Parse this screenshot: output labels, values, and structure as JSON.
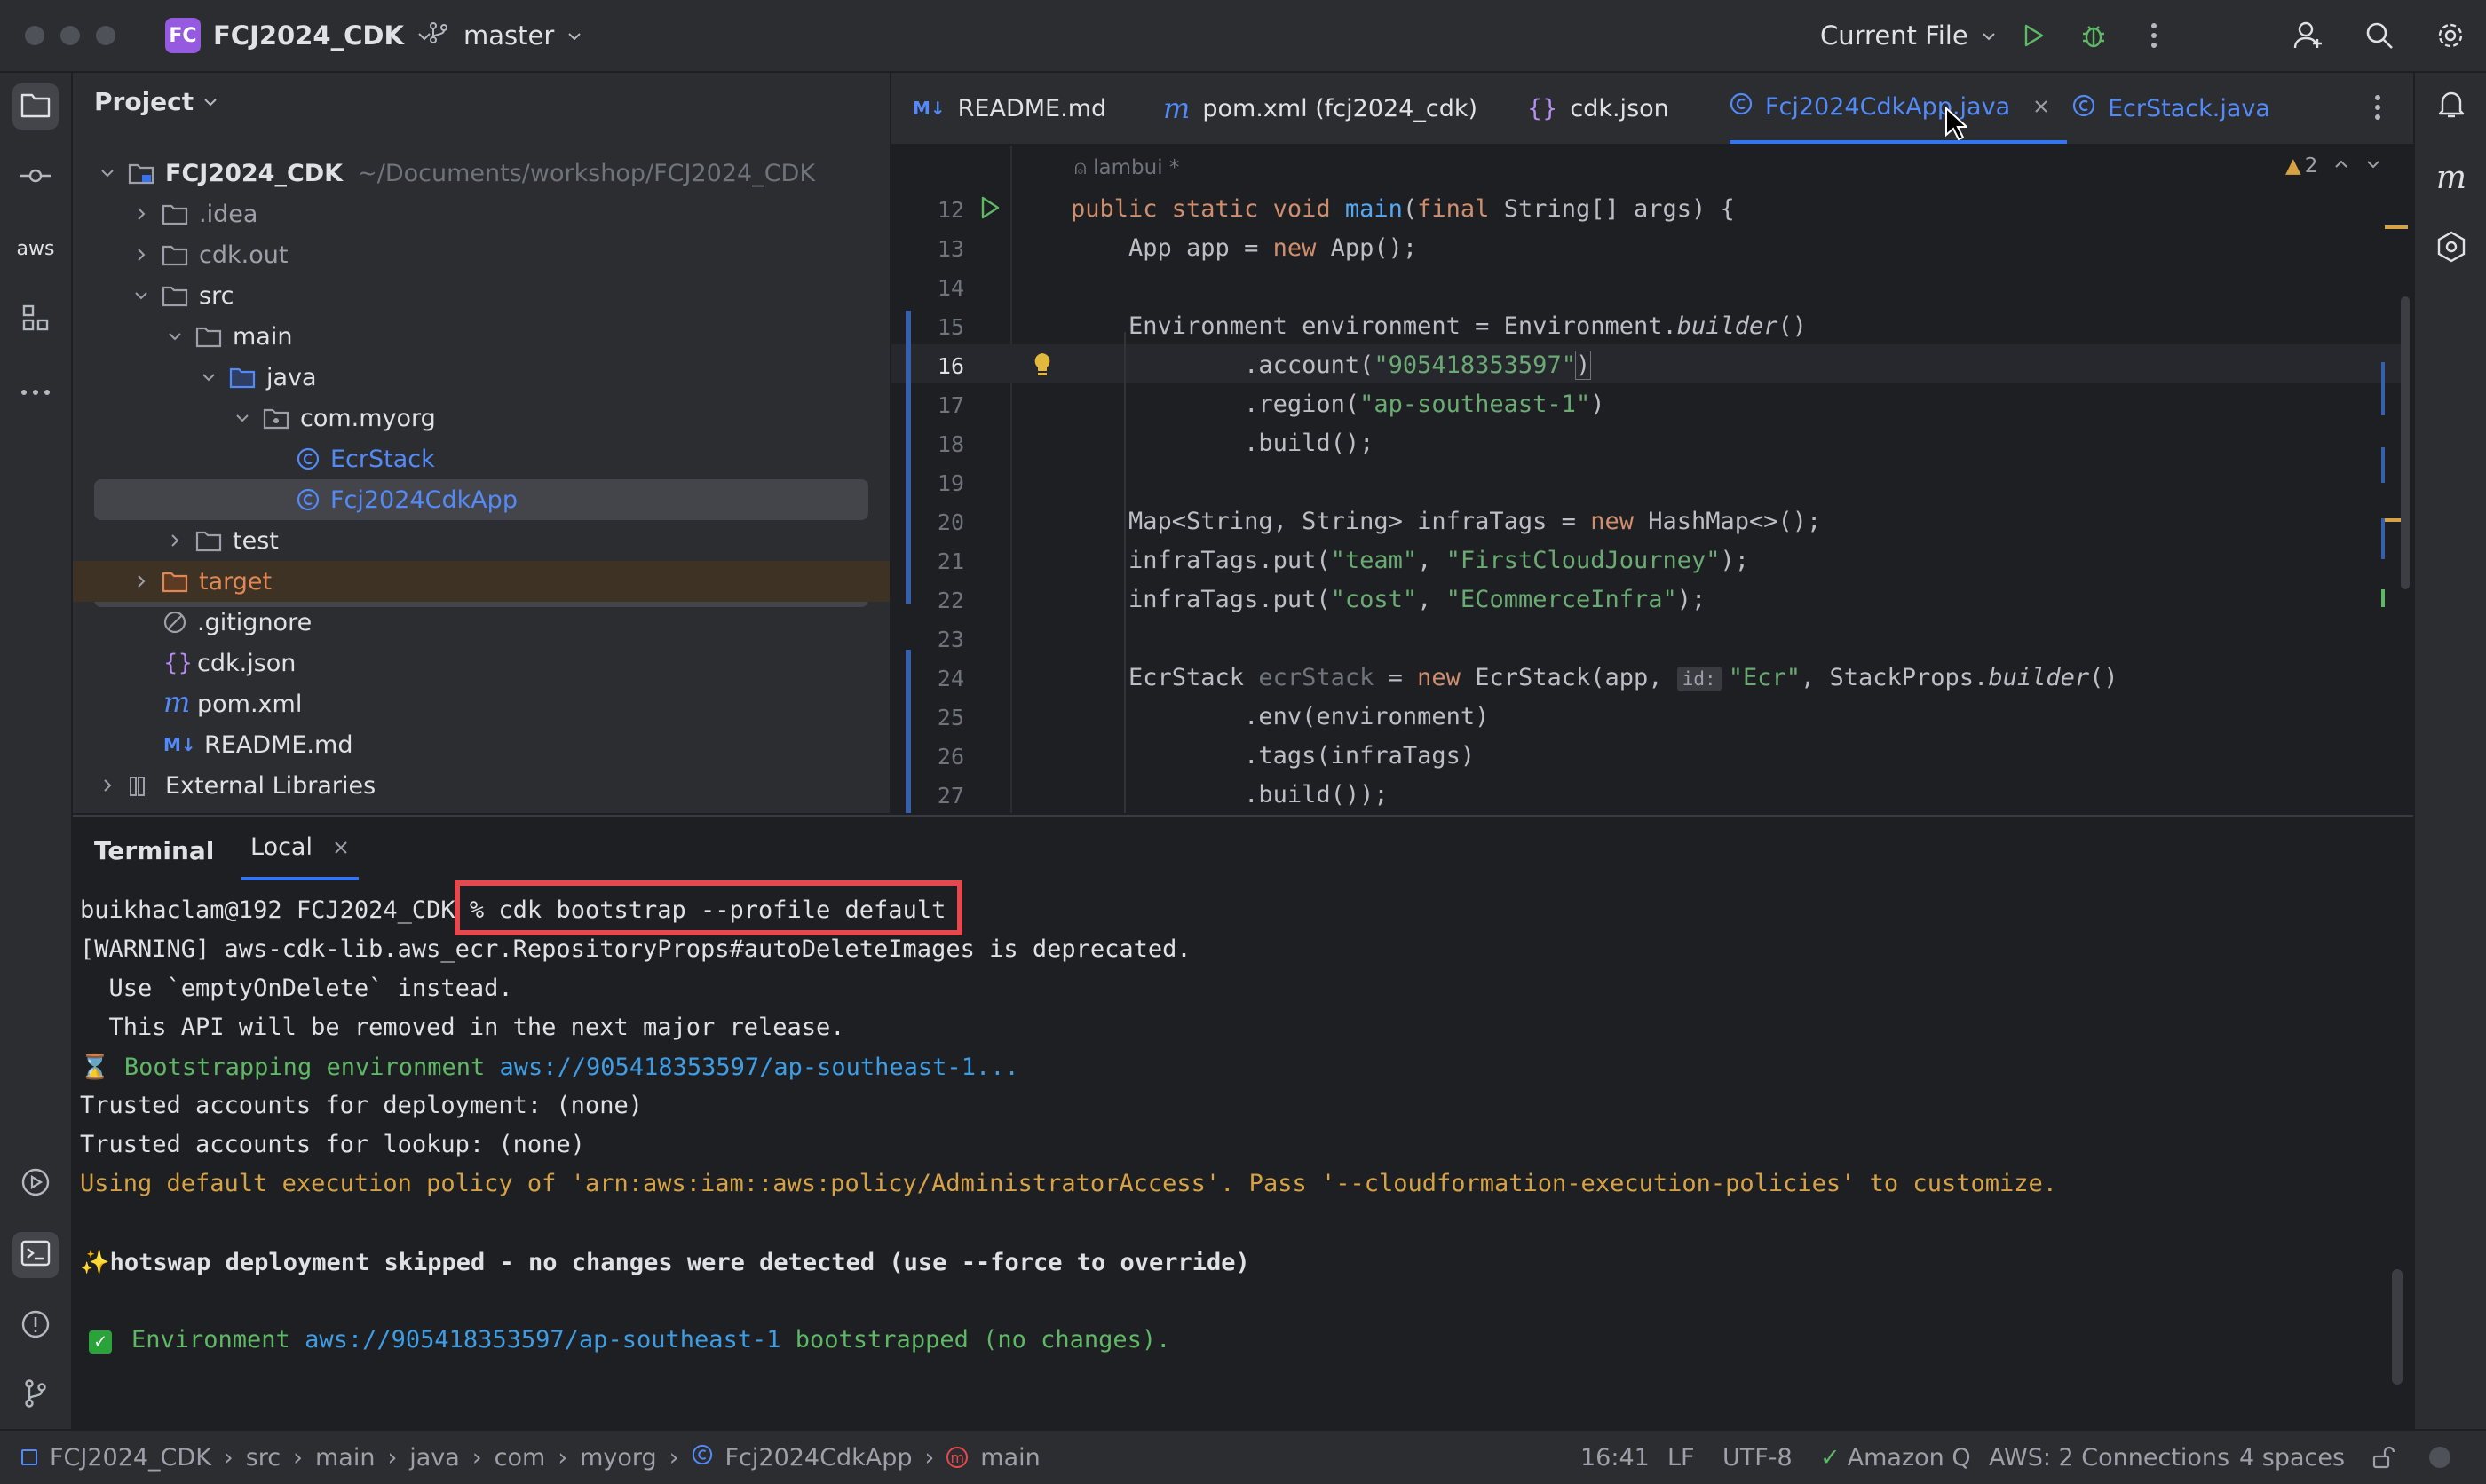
{
  "window": {
    "project_badge": "FC",
    "project_name": "FCJ2024_CDK",
    "branch": "master",
    "run_config": "Current File"
  },
  "project_panel": {
    "title": "Project",
    "tree": [
      {
        "label": "FCJ2024_CDK",
        "path": "~/Documents/workshop/FCJ2024_CDK"
      },
      {
        "label": ".idea"
      },
      {
        "label": "cdk.out"
      },
      {
        "label": "src"
      },
      {
        "label": "main"
      },
      {
        "label": "java"
      },
      {
        "label": "com.myorg"
      },
      {
        "label": "EcrStack"
      },
      {
        "label": "Fcj2024CdkApp"
      },
      {
        "label": "test"
      },
      {
        "label": "target"
      },
      {
        "label": ".gitignore"
      },
      {
        "label": "cdk.json"
      },
      {
        "label": "pom.xml"
      },
      {
        "label": "README.md"
      },
      {
        "label": "External Libraries"
      }
    ]
  },
  "tabs": [
    {
      "label": "README.md"
    },
    {
      "label": "pom.xml (fcj2024_cdk)"
    },
    {
      "label": "cdk.json"
    },
    {
      "label": "Fcj2024CdkApp.java"
    },
    {
      "label": "EcrStack.java"
    }
  ],
  "editor": {
    "author_hint": "lambui *",
    "warnings_count": "2",
    "inlay_hint": "id:",
    "line_numbers": [
      "12",
      "13",
      "14",
      "15",
      "16",
      "17",
      "18",
      "19",
      "20",
      "21",
      "22",
      "23",
      "24",
      "25",
      "26",
      "27"
    ],
    "code": {
      "l12_kw1": "public static void ",
      "l12_fn": "main",
      "l12_p1": "(",
      "l12_kw2": "final ",
      "l12_rest": "String[] args) {",
      "l13_a": "    App app = ",
      "l13_kw": "new ",
      "l13_b": "App();",
      "l15_a": "    Environment environment = Environment.",
      "l15_it": "builder",
      "l15_b": "()",
      "l16_a": "            .account(",
      "l16_str": "\"905418353597\"",
      "l16_b": ")",
      "l17_a": "            .region(",
      "l17_str": "\"ap-southeast-1\"",
      "l17_b": ")",
      "l18": "            .build();",
      "l20_a": "    Map<String, String> infraTags = ",
      "l20_kw": "new ",
      "l20_b": "HashMap<>();",
      "l21_a": "    infraTags.put(",
      "l21_s1": "\"team\"",
      "l21_c": ", ",
      "l21_s2": "\"FirstCloudJourney\"",
      "l21_b": ");",
      "l22_a": "    infraTags.put(",
      "l22_s1": "\"cost\"",
      "l22_c": ", ",
      "l22_s2": "\"ECommerceInfra\"",
      "l22_b": ");",
      "l24_a": "    EcrStack ",
      "l24_var": "ecrStack",
      "l24_b": " = ",
      "l24_kw": "new ",
      "l24_c": "EcrStack(app, ",
      "l24_str": "\"Ecr\"",
      "l24_d": ", StackProps.",
      "l24_it": "builder",
      "l24_e": "()",
      "l25": "            .env(environment)",
      "l26": "            .tags(infraTags)",
      "l27": "            .build());"
    }
  },
  "terminal": {
    "title": "Terminal",
    "tab": "Local",
    "prompt": "buikhaclam@192 FCJ2024_CDK ",
    "command": "% cdk bootstrap --profile default",
    "lines": [
      "[WARNING] aws-cdk-lib.aws_ecr.RepositoryProps#autoDeleteImages is deprecated.",
      "  Use `emptyOnDelete` instead.",
      "  This API will be removed in the next major release.",
      "Trusted accounts for deployment: (none)",
      "Trusted accounts for lookup: (none)",
      "Using default execution policy of 'arn:aws:iam::aws:policy/AdministratorAccess'. Pass '--cloudformation-execution-policies' to customize.",
      "hotswap deployment skipped - no changes were detected (use --force to override)"
    ],
    "bootstrap_prefix": "Bootstrapping environment ",
    "bootstrap_env": "aws://905418353597/ap-southeast-1...",
    "done_prefix": "Environment ",
    "done_env": "aws://905418353597/ap-southeast-1",
    "done_suffix": " bootstrapped (no changes)."
  },
  "statusbar": {
    "breadcrumb": [
      "FCJ2024_CDK",
      "src",
      "main",
      "java",
      "com",
      "myorg",
      "Fcj2024CdkApp",
      "main"
    ],
    "position": "16:41",
    "line_sep": "LF",
    "encoding": "UTF-8",
    "amazon_q": "Amazon Q",
    "aws": "AWS: 2 Connections",
    "indent": "4 spaces"
  },
  "colors": {
    "accent_blue": "#3574f0",
    "highlight_red": "#e5484d",
    "keyword": "#cf8e6d",
    "string": "#6aab73"
  }
}
